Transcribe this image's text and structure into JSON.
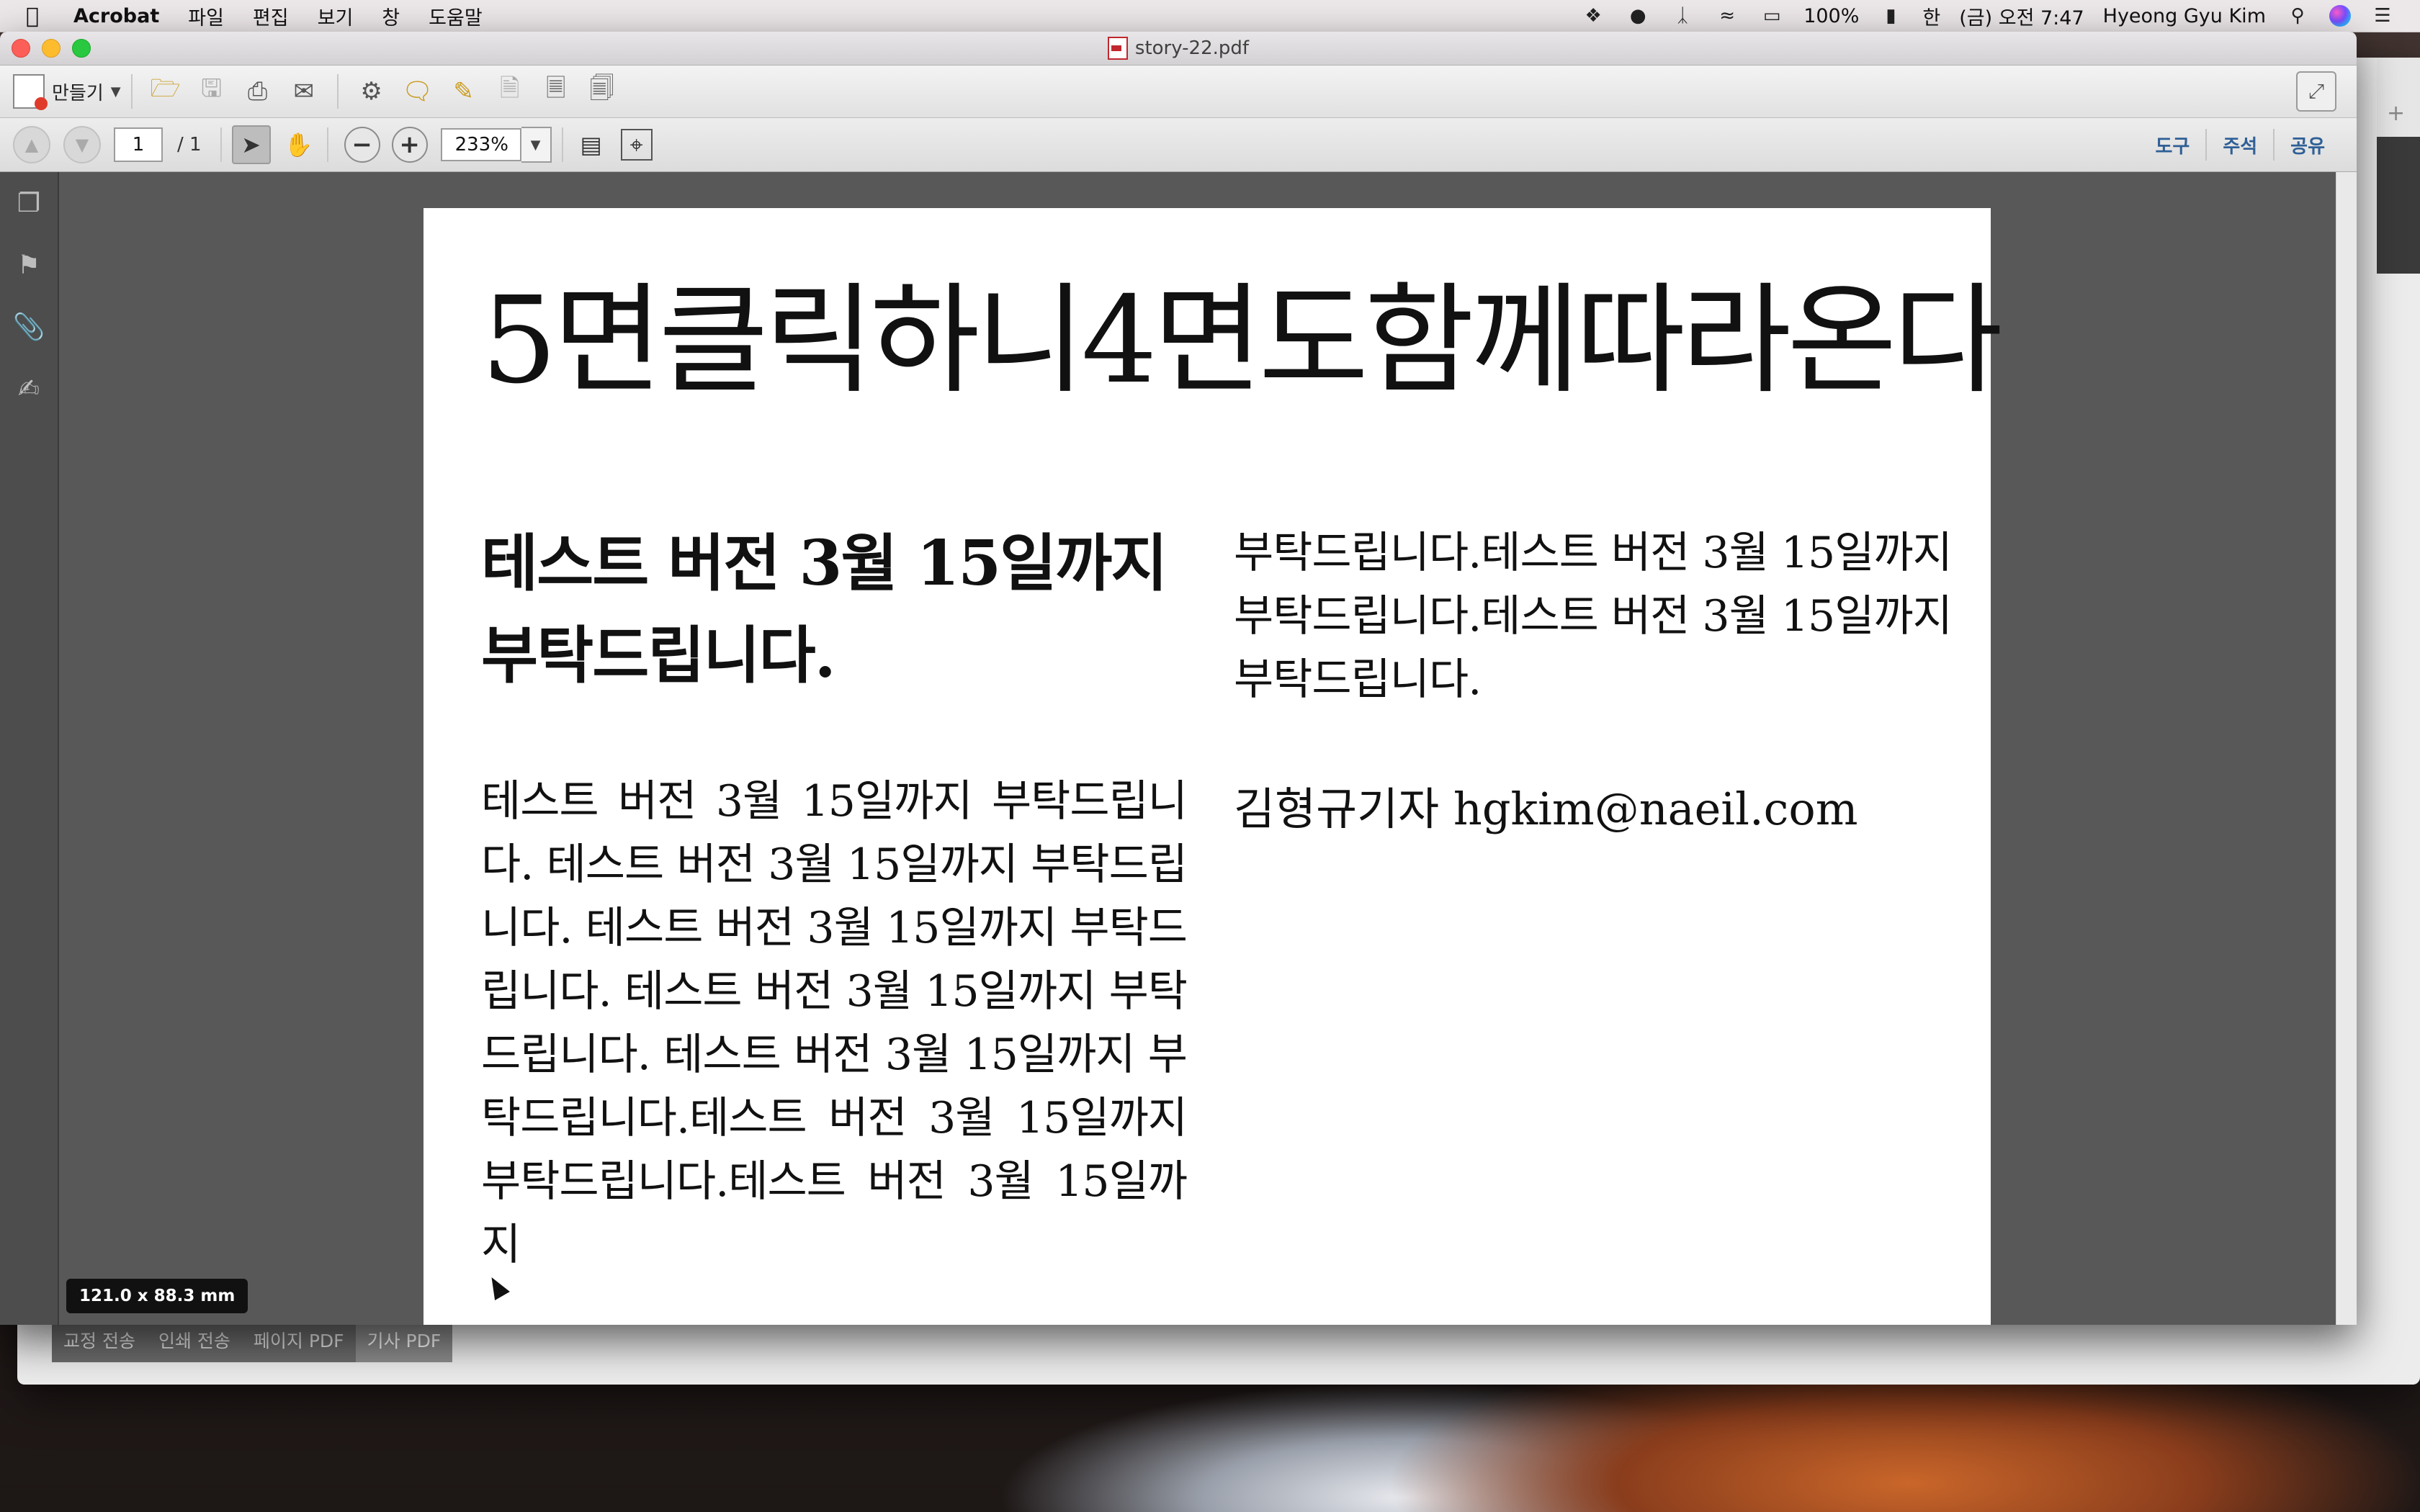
{
  "menubar": {
    "app_name": "Acrobat",
    "menus": [
      "파일",
      "편집",
      "보기",
      "창",
      "도움말"
    ],
    "battery": "100%",
    "input_method": "한",
    "clock": "(금) 오전 7:47",
    "user": "Hyeong Gyu Kim"
  },
  "window": {
    "title": "story-22.pdf"
  },
  "toolbar": {
    "create_label": "만들기",
    "page_current": "1",
    "page_total": "/ 1",
    "zoom": "233%",
    "links": [
      "도구",
      "주석",
      "공유"
    ]
  },
  "document": {
    "headline": "5면클릭하니4면도함께따라온다",
    "subhead": "테스트 버전 3월 15일까지 부탁드립니다.",
    "body_left": "테스트 버전 3월 15일까지 부탁드립니다. 테스트 버전 3월 15일까지 부탁드립니다. 테스트 버전 3월 15일까지 부탁드립니다. 테스트 버전 3월 15일까지 부탁드립니다. 테스트 버전 3월 15일까지 부탁드립니다.테스트 버전 3월 15일까지 부탁드립니다.테스트 버전 3월 15일까지",
    "body_right": "부탁드립니다.테스트 버전 3월 15일까지 부탁드립니다.테스트 버전 3월 15일까지 부탁드립니다.",
    "byline": "김형규기자 hgkim@naeil.com"
  },
  "status": {
    "dimensions": "121.0 x 88.3 mm"
  },
  "back_window": {
    "tabs": [
      "교정 전송",
      "인쇄 전송",
      "페이지 PDF",
      "기사 PDF"
    ]
  },
  "colors": {
    "link_blue": "#2f5f96",
    "canvas_gray": "#585858"
  }
}
